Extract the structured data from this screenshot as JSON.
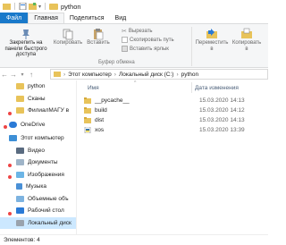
{
  "window": {
    "title": "python"
  },
  "ribbon_tabs": [
    "Файл",
    "Главная",
    "Поделиться",
    "Вид"
  ],
  "ribbon": {
    "pin_label": "Закрепить на панели быстрого доступа",
    "copy_label": "Копировать",
    "paste_label": "Вставить",
    "cut_label": "Вырезать",
    "copy_path_label": "Скопировать путь",
    "paste_shortcut_label": "Вставить ярлык",
    "clipboard_group": "Буфер обмена",
    "move_to_label": "Переместить в",
    "copy_to_label": "Копировать в"
  },
  "address": {
    "crumbs": [
      "Этот компьютер",
      "Локальный диск (C:)",
      "python"
    ]
  },
  "sidebar": {
    "items": [
      {
        "label": "python",
        "icon": "folder-icon"
      },
      {
        "label": "Сканы",
        "icon": "folder-icon"
      },
      {
        "label": "ФилиалМАГУ в",
        "icon": "folder-icon"
      },
      {
        "label": "OneDrive",
        "icon": "cloud-icon"
      },
      {
        "label": "Этот компьютер",
        "icon": "computer-icon"
      },
      {
        "label": "Видео",
        "icon": "video-icon"
      },
      {
        "label": "Документы",
        "icon": "documents-icon"
      },
      {
        "label": "Изображения",
        "icon": "images-icon"
      },
      {
        "label": "Музыка",
        "icon": "music-icon"
      },
      {
        "label": "Объемные объ",
        "icon": "3d-icon"
      },
      {
        "label": "Рабочий стол",
        "icon": "desktop-icon"
      },
      {
        "label": "Локальный диск",
        "icon": "drive-icon"
      }
    ]
  },
  "content": {
    "columns": {
      "name": "Имя",
      "date": "Дата изменения"
    },
    "files": [
      {
        "name": "__pycache__",
        "date": "15.03.2020 14:13",
        "icon": "folder-icon"
      },
      {
        "name": "build",
        "date": "15.03.2020 14:12",
        "icon": "folder-icon"
      },
      {
        "name": "dist",
        "date": "15.03.2020 14:13",
        "icon": "folder-icon"
      },
      {
        "name": "xos",
        "date": "15.03.2020 13:39",
        "icon": "python-file-icon"
      }
    ]
  },
  "status": {
    "items_text": "Элементов: 4"
  },
  "colors": {
    "file_tab": "#1979ca",
    "folder": "#e8c35a",
    "selected": "#cce8ff"
  }
}
